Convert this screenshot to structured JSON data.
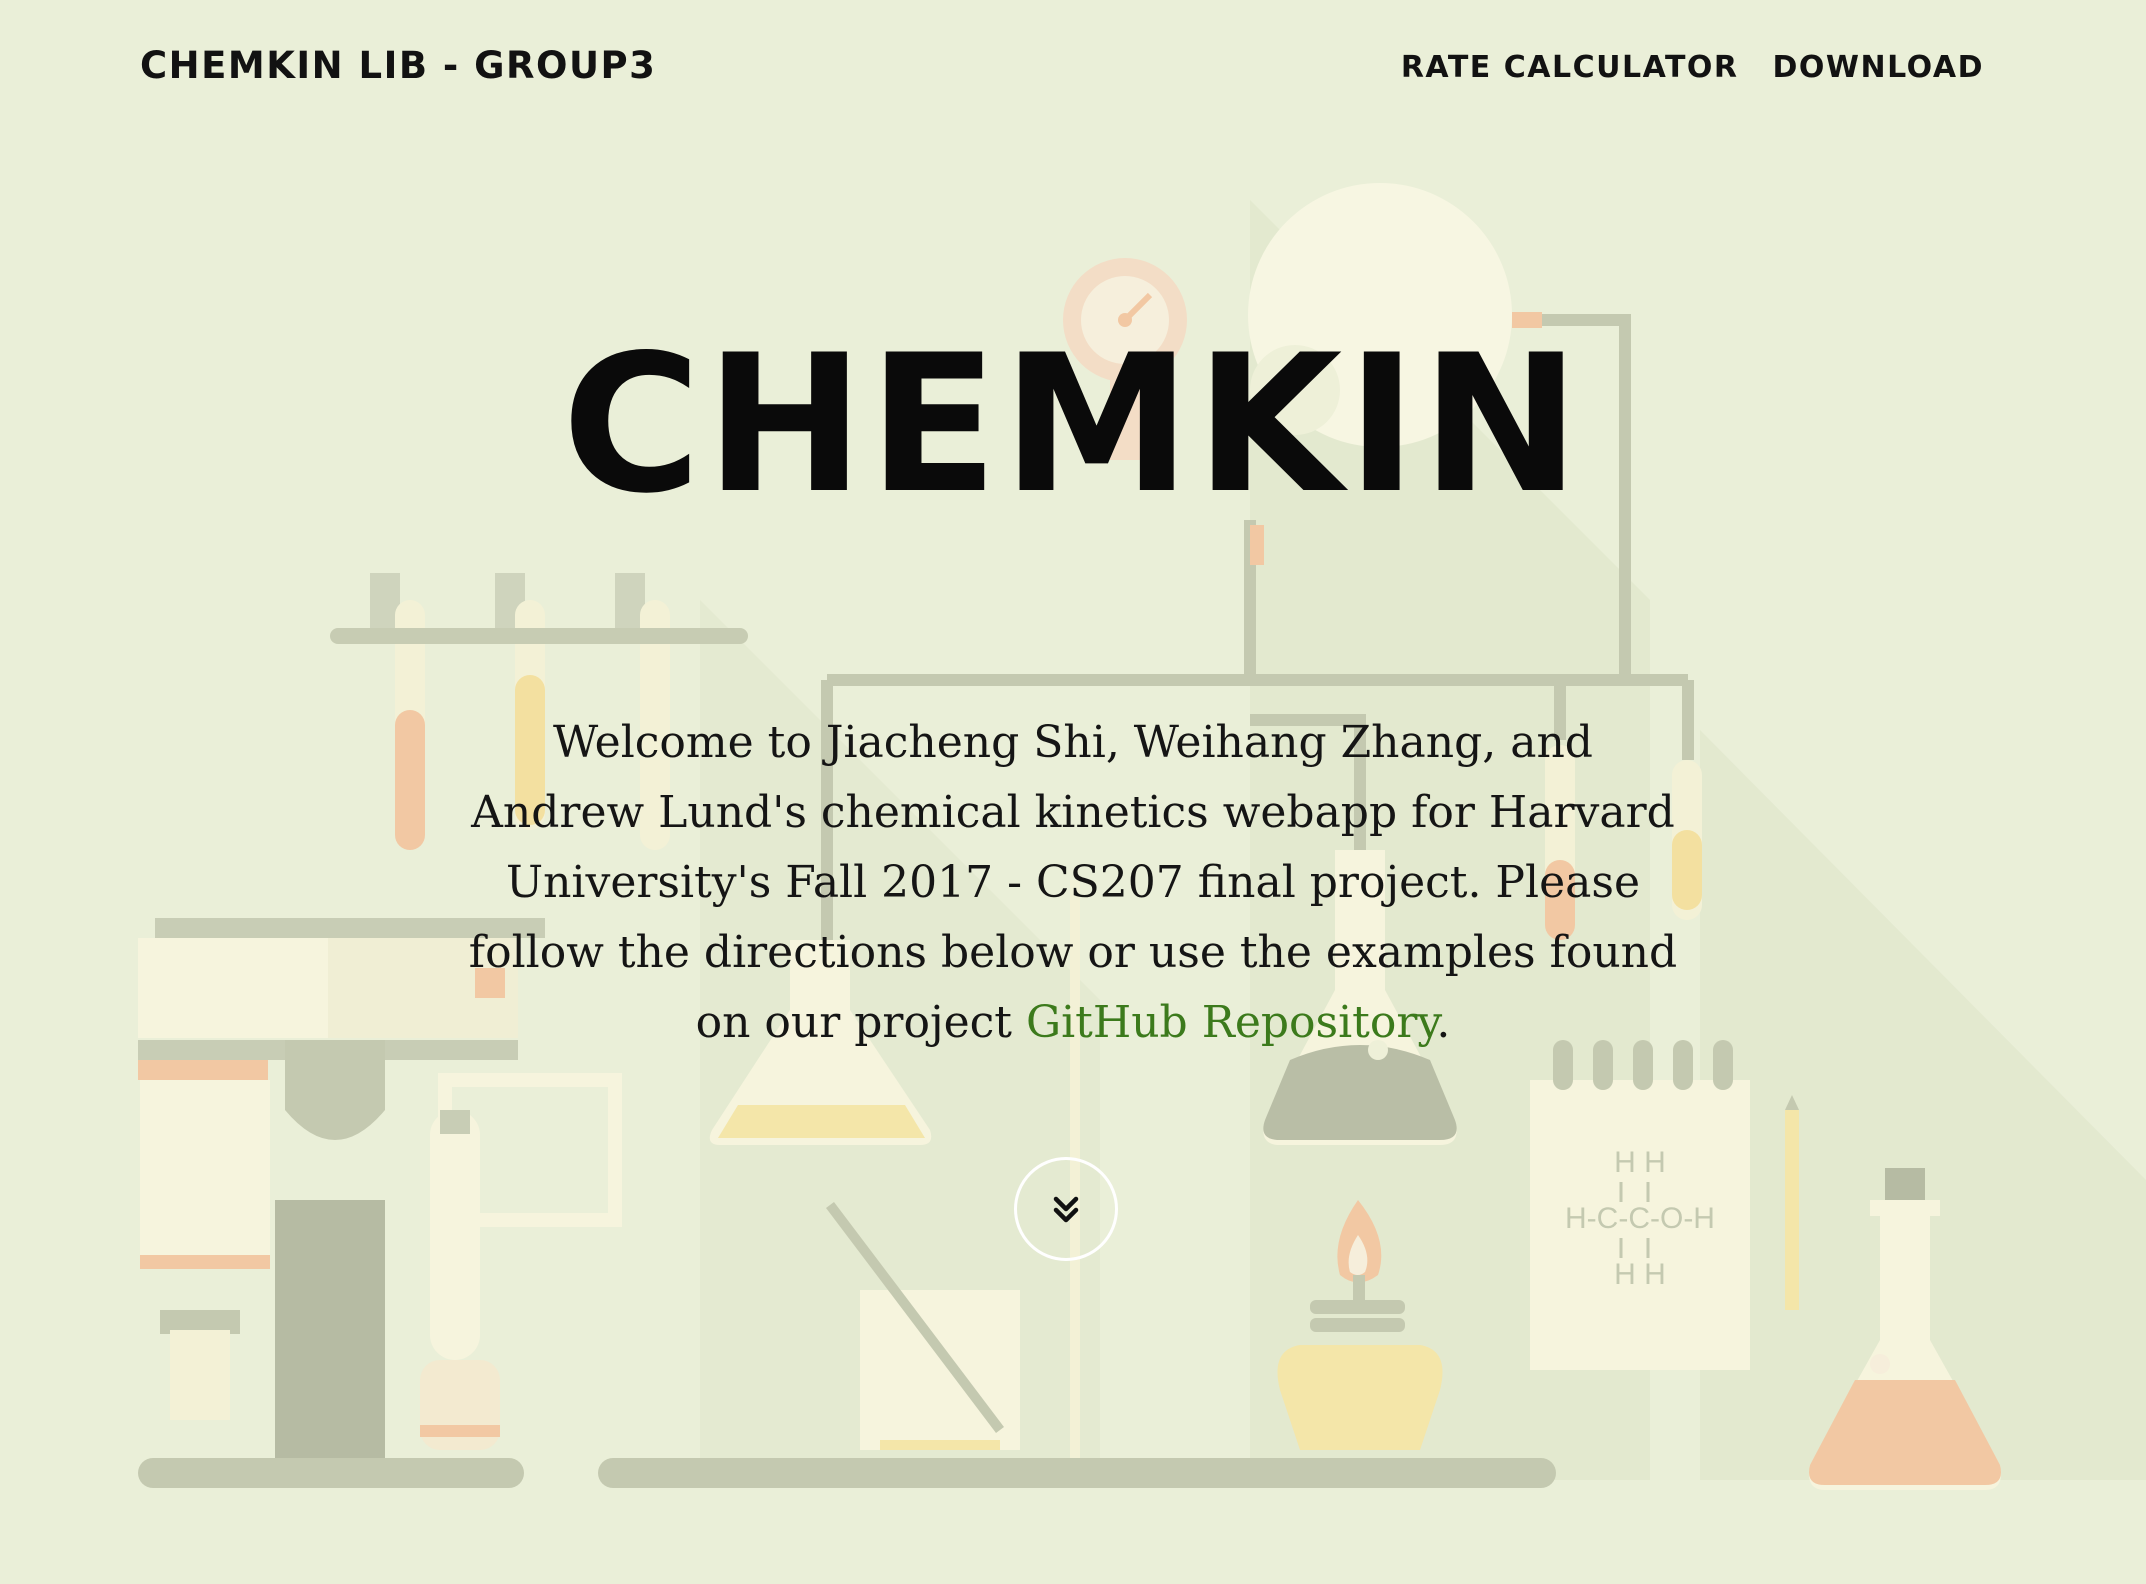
{
  "nav": {
    "brand": "CHEMKIN LIB - GROUP3",
    "links": [
      "RATE CALCULATOR",
      "DOWNLOAD"
    ]
  },
  "hero": {
    "title": "CHEMKIN",
    "intro_text": "Welcome to Jiacheng Shi, Weihang Zhang, and Andrew Lund's chemical kinetics webapp for Harvard University's Fall 2017 - CS207 final project. Please follow the directions below or use the examples found on our project ",
    "link_text": "GitHub Repository",
    "intro_end": "."
  },
  "colors": {
    "background": "#eaefd8",
    "link": "#3c7a1c",
    "text": "#121212"
  },
  "icons": {
    "scroll_button": "chevron-double-down-icon"
  }
}
